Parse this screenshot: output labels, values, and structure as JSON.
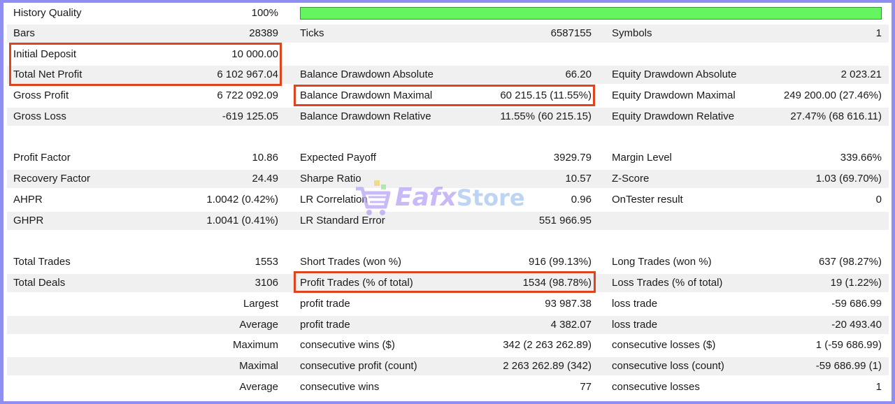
{
  "rows": [
    {
      "c1l": "History Quality",
      "c1v": "100%"
    },
    {
      "c1l": "Bars",
      "c1v": "28389",
      "c2l": "Ticks",
      "c2v": "6587155",
      "c3l": "Symbols",
      "c3v": "1"
    },
    {
      "c1l": "Initial Deposit",
      "c1v": "10 000.00"
    },
    {
      "c1l": "Total Net Profit",
      "c1v": "6 102 967.04",
      "c2l": "Balance Drawdown Absolute",
      "c2v": "66.20",
      "c3l": "Equity Drawdown Absolute",
      "c3v": "2 023.21"
    },
    {
      "c1l": "Gross Profit",
      "c1v": "6 722 092.09",
      "c2l": "Balance Drawdown Maximal",
      "c2v": "60 215.15 (11.55%)",
      "c3l": "Equity Drawdown Maximal",
      "c3v": "249 200.00 (27.46%)"
    },
    {
      "c1l": "Gross Loss",
      "c1v": "-619 125.05",
      "c2l": "Balance Drawdown Relative",
      "c2v": "11.55% (60 215.15)",
      "c3l": "Equity Drawdown Relative",
      "c3v": "27.47% (68 616.11)"
    },
    {},
    {
      "c1l": "Profit Factor",
      "c1v": "10.86",
      "c2l": "Expected Payoff",
      "c2v": "3929.79",
      "c3l": "Margin Level",
      "c3v": "339.66%"
    },
    {
      "c1l": "Recovery Factor",
      "c1v": "24.49",
      "c2l": "Sharpe Ratio",
      "c2v": "10.57",
      "c3l": "Z-Score",
      "c3v": "1.03 (69.70%)"
    },
    {
      "c1l": "AHPR",
      "c1v": "1.0042 (0.42%)",
      "c2l": "LR Correlation",
      "c2v": "0.96",
      "c3l": "OnTester result",
      "c3v": "0"
    },
    {
      "c1l": "GHPR",
      "c1v": "1.0041 (0.41%)",
      "c2l": "LR Standard Error",
      "c2v": "551 966.95"
    },
    {},
    {
      "c1l": "Total Trades",
      "c1v": "1553",
      "c2l": "Short Trades (won %)",
      "c2v": "916 (99.13%)",
      "c3l": "Long Trades (won %)",
      "c3v": "637 (98.27%)"
    },
    {
      "c1l": "Total Deals",
      "c1v": "3106",
      "c2l": "Profit Trades (% of total)",
      "c2v": "1534 (98.78%)",
      "c3l": "Loss Trades (% of total)",
      "c3v": "19 (1.22%)"
    },
    {
      "c1v": "Largest",
      "c2l": "profit trade",
      "c2v": "93 987.38",
      "c3l": "loss trade",
      "c3v": "-59 686.99"
    },
    {
      "c1v": "Average",
      "c2l": "profit trade",
      "c2v": "4 382.07",
      "c3l": "loss trade",
      "c3v": "-20 493.40"
    },
    {
      "c1v": "Maximum",
      "c2l": "consecutive wins ($)",
      "c2v": "342 (2 263 262.89)",
      "c3l": "consecutive losses ($)",
      "c3v": "1 (-59 686.99)"
    },
    {
      "c1v": "Maximal",
      "c2l": "consecutive profit (count)",
      "c2v": "2 263 262.89 (342)",
      "c3l": "consecutive loss (count)",
      "c3v": "-59 686.99 (1)"
    },
    {
      "c1v": "Average",
      "c2l": "consecutive wins",
      "c2v": "77",
      "c3l": "consecutive losses",
      "c3v": "1"
    }
  ],
  "history_quality_fill": 1.0,
  "watermark": {
    "brand": "Eafx",
    "suffix": "Store",
    "icon": "shopping-cart-icon"
  },
  "colors": {
    "bar_fill": "#65f55f",
    "highlight": "#e0441c",
    "frame": "#8f8ff2"
  }
}
